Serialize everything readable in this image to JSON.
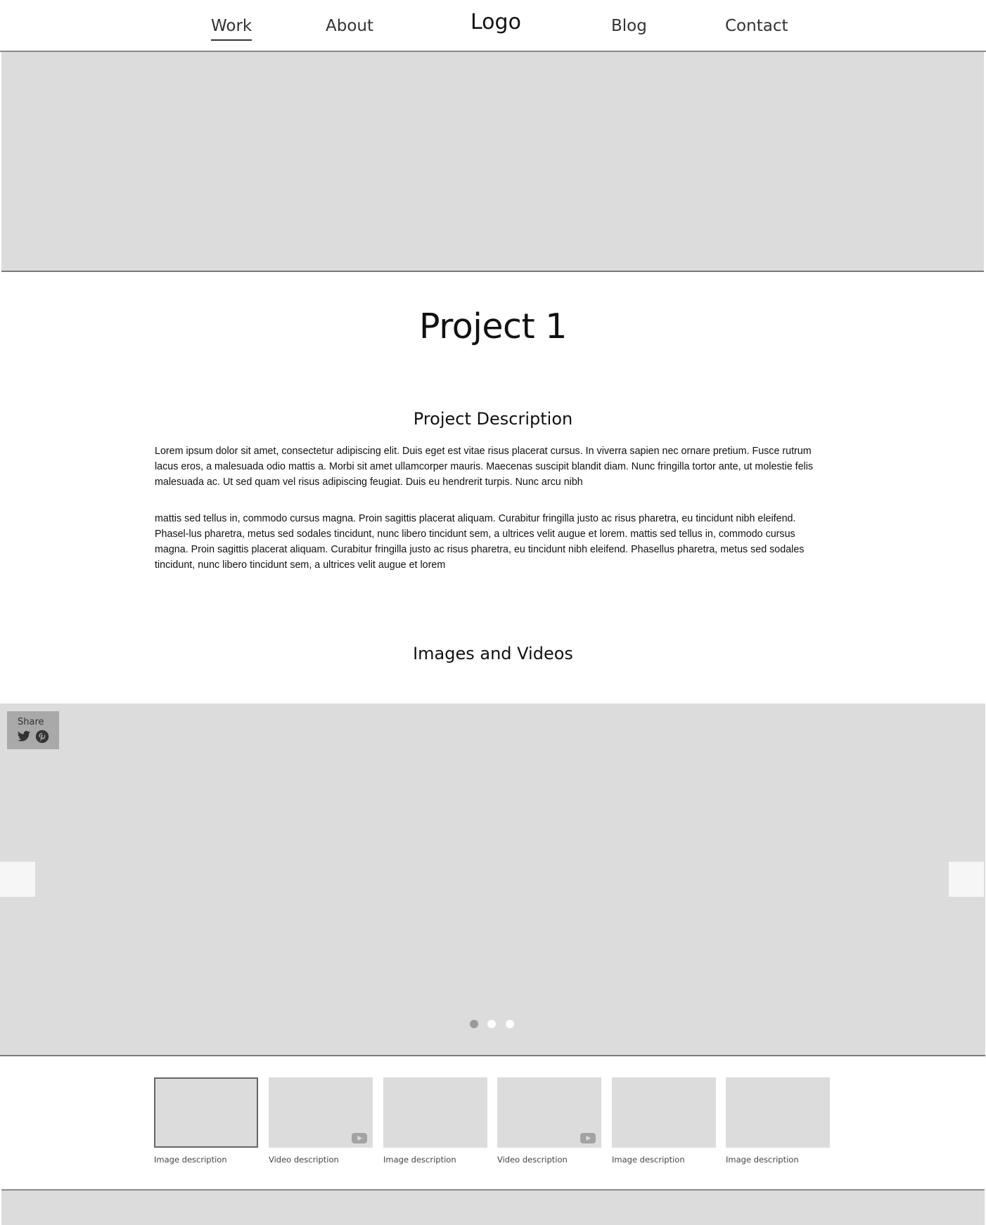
{
  "nav": {
    "items": [
      {
        "label": "Work"
      },
      {
        "label": "About"
      },
      {
        "label": "Logo"
      },
      {
        "label": "Blog"
      },
      {
        "label": "Contact"
      }
    ]
  },
  "project": {
    "title": "Project 1"
  },
  "description": {
    "heading": "Project Description",
    "paragraphs": [
      "Lorem ipsum dolor sit amet, consectetur adipiscing elit. Duis eget est vitae risus placerat cursus. In viverra sapien nec ornare pretium. Fusce rutrum lacus eros, a malesuada odio mattis a. Morbi sit amet ullamcorper mauris. Maecenas suscipit blandit diam. Nunc fringilla tortor ante, ut molestie felis malesuada ac. Ut sed quam vel risus adipiscing feugiat. Duis eu hendrerit turpis. Nunc arcu nibh",
      "mattis sed tellus in, commodo cursus magna. Proin sagittis placerat aliquam. Curabitur fringilla justo ac risus pharetra, eu tincidunt nibh eleifend. Phasel-lus pharetra, metus sed sodales tincidunt, nunc libero tincidunt sem, a ultrices velit augue et lorem. mattis sed tellus in, commodo cursus magna. Proin sagittis placerat aliquam. Curabitur fringilla justo ac risus pharetra, eu tincidunt nibh eleifend. Phasellus pharetra, metus sed sodales tincidunt, nunc libero tincidunt sem, a ultrices velit augue et lorem"
    ]
  },
  "media": {
    "heading": "Images and Videos",
    "share_label": "Share",
    "share_icons": [
      "twitter-icon",
      "pinterest-icon"
    ],
    "carousel_dots": 3,
    "active_dot": 1,
    "thumbnails": [
      {
        "caption": "Image description",
        "type": "image",
        "selected": true
      },
      {
        "caption": "Video description",
        "type": "video",
        "selected": false
      },
      {
        "caption": "Image description",
        "type": "image",
        "selected": false
      },
      {
        "caption": "Video description",
        "type": "video",
        "selected": false
      },
      {
        "caption": "Image description",
        "type": "image",
        "selected": false
      },
      {
        "caption": "Image description",
        "type": "image",
        "selected": false
      }
    ]
  },
  "colors": {
    "placeholder": "#dcdcdc",
    "divider": "#8a8a8a",
    "share_box": "#a9a9a9",
    "active_dot": "#9a9a9a",
    "inactive_dot": "#ffffff"
  }
}
